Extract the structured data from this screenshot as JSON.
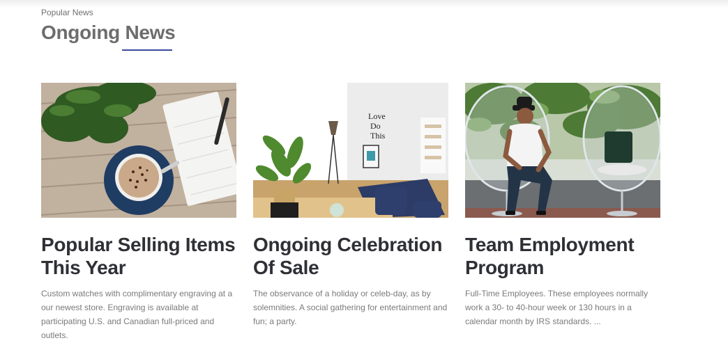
{
  "section": {
    "eyebrow": "Popular News",
    "title": "Ongoing News",
    "accent_color": "#3b4a9e"
  },
  "cards": [
    {
      "image_icon": "coffee-notebook-photo",
      "title": "Popular Selling Items This Year",
      "description": "Custom watches with complimentary engraving at a our newest store. Engraving is available at participating U.S. and Canadian full-priced and outlets."
    },
    {
      "image_icon": "interior-room-photo",
      "title": "Ongoing Celebration Of Sale",
      "description": "The observance of a holiday or celeb-day, as by solemnities. A social gathering for entertainment and fun; a party."
    },
    {
      "image_icon": "man-in-chair-photo",
      "title": "Team Employment Program",
      "description": "Full-Time Employees. These employees normally work a 30- to 40-hour week or 130 hours in a calendar month by IRS standards. ..."
    }
  ]
}
